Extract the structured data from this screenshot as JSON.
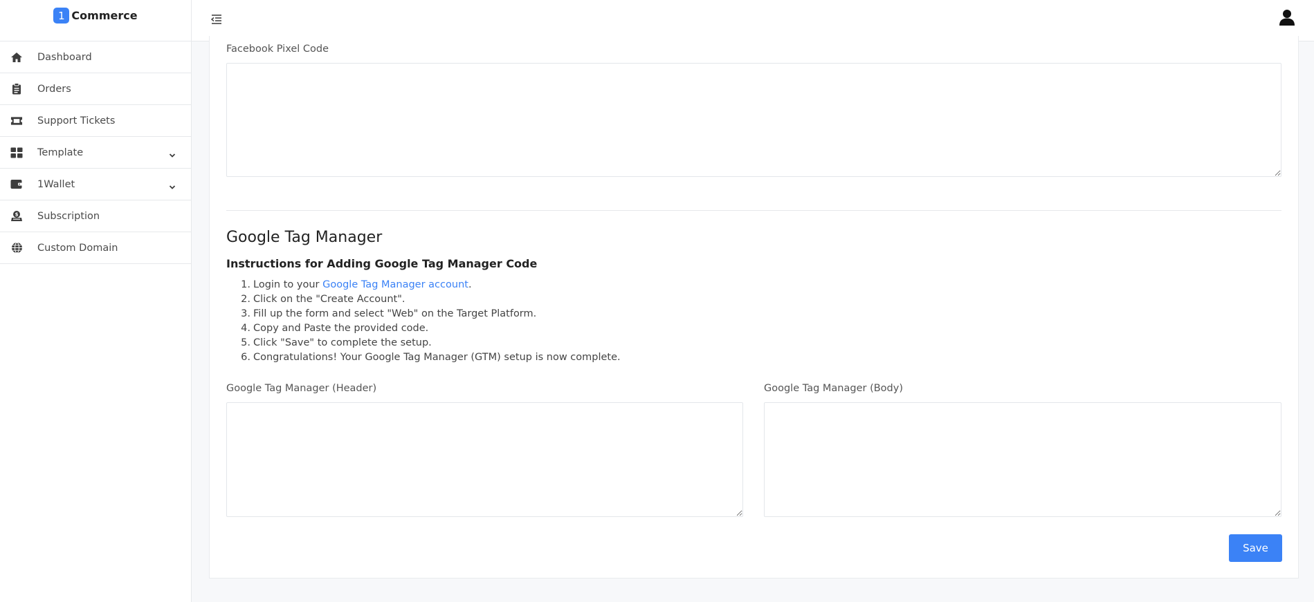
{
  "brand": {
    "badge": "1",
    "name": "Commerce"
  },
  "sidebar": {
    "items": [
      {
        "label": "Dashboard",
        "icon": "home-icon",
        "has_submenu": false
      },
      {
        "label": "Orders",
        "icon": "clipboard-icon",
        "has_submenu": false
      },
      {
        "label": "Support Tickets",
        "icon": "ticket-icon",
        "has_submenu": false
      },
      {
        "label": "Template",
        "icon": "grid-icon",
        "has_submenu": true
      },
      {
        "label": "1Wallet",
        "icon": "wallet-icon",
        "has_submenu": true
      },
      {
        "label": "Subscription",
        "icon": "subscription-icon",
        "has_submenu": false
      },
      {
        "label": "Custom Domain",
        "icon": "globe-icon",
        "has_submenu": false
      }
    ]
  },
  "topbar": {
    "menu_toggle_icon": "indent-icon",
    "user_icon": "user-icon"
  },
  "facebook": {
    "label": "Facebook Pixel Code",
    "value": ""
  },
  "gtm": {
    "title": "Google Tag Manager",
    "instructions_title": "Instructions for Adding Google Tag Manager Code",
    "steps": [
      {
        "num": "1.",
        "prefix": "Login to your ",
        "link": "Google Tag Manager account",
        "suffix": "."
      },
      {
        "num": "2.",
        "text": "Click on the \"Create Account\"."
      },
      {
        "num": "3.",
        "text": "Fill up the form and select \"Web\" on the Target Platform."
      },
      {
        "num": "4.",
        "text": "Copy and Paste the provided code."
      },
      {
        "num": "5.",
        "text": "Click \"Save\" to complete the setup."
      },
      {
        "num": "6.",
        "text": "Congratulations! Your Google Tag Manager (GTM) setup is now complete."
      }
    ],
    "header_label": "Google Tag Manager (Header)",
    "header_value": "",
    "body_label": "Google Tag Manager (Body)",
    "body_value": ""
  },
  "actions": {
    "save_label": "Save"
  },
  "colors": {
    "accent": "#3b82f6",
    "background": "#f7f8fa",
    "border": "#e6e8eb"
  }
}
